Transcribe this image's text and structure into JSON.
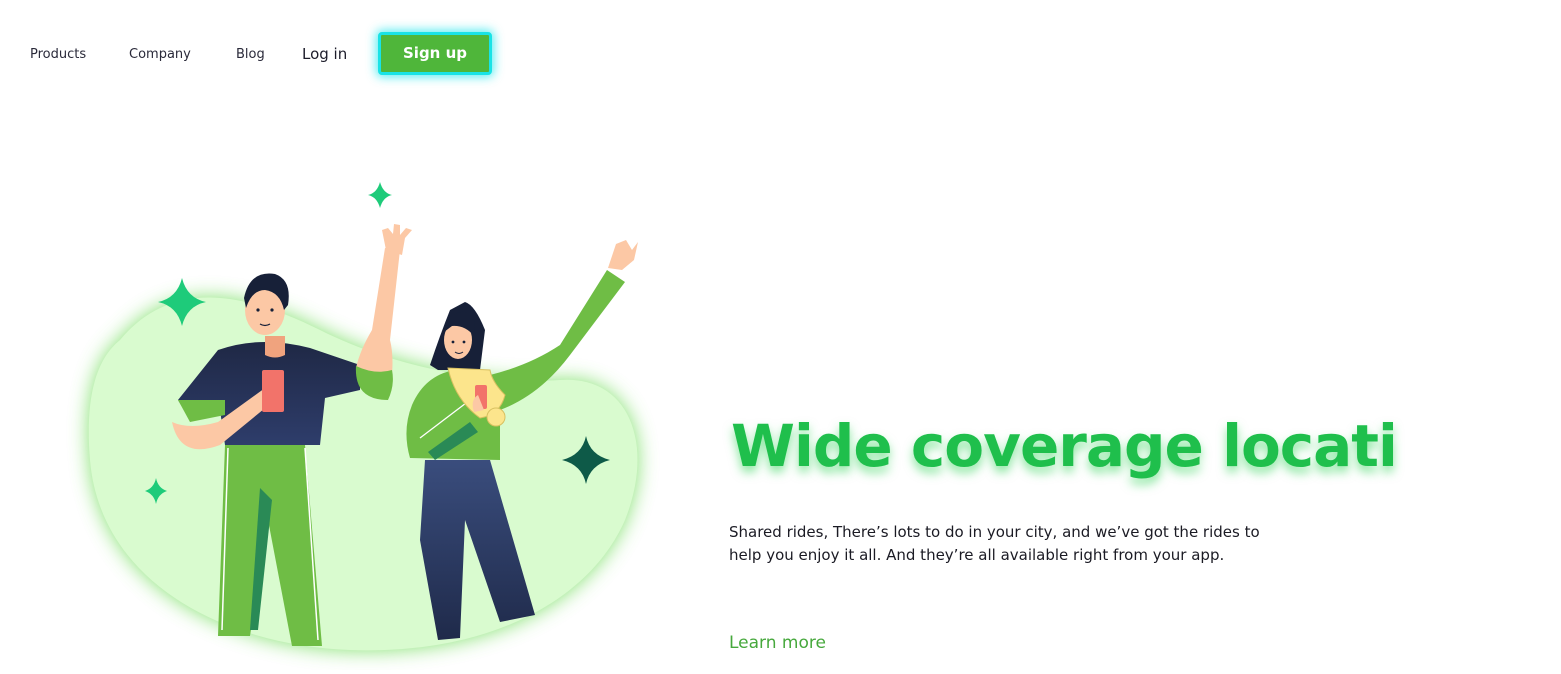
{
  "nav": {
    "products_label": "Products",
    "company_label": "Company",
    "blog_label": "Blog",
    "login_label": "Log in",
    "signup_label": "Sign up"
  },
  "hero": {
    "headline": "Wide coverage locati",
    "description": "Shared rides, There’s lots to do in your city, and we’ve got the rides to help you enjoy it all. And they’re all available right from your app.",
    "cta_label": "Learn more",
    "illustration_icon": "two-people-waving-illustration"
  },
  "colors": {
    "brand_green": "#4fb63a",
    "headline_green": "#1fbf4c",
    "cta_green": "#46a83c",
    "signup_outline": "#19e3e6",
    "blob_fill": "#d9fbcf"
  }
}
